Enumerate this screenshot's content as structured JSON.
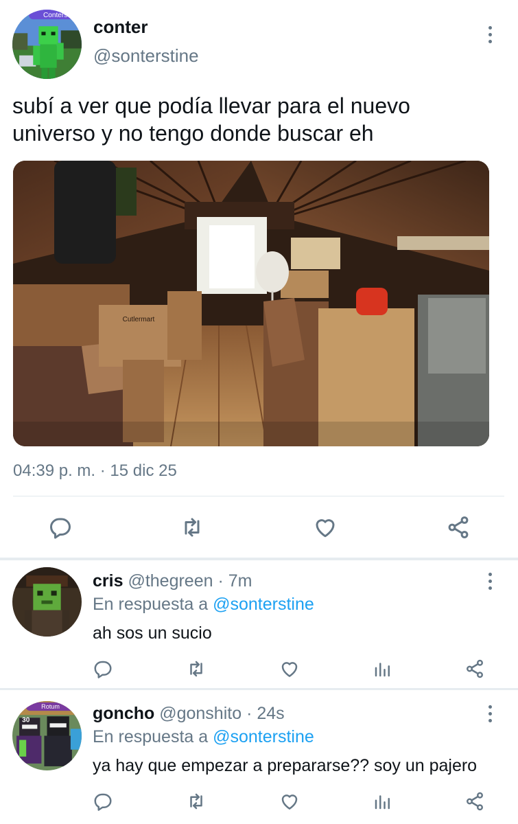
{
  "tweet": {
    "author_name": "conter",
    "author_handle": "@sonterstine",
    "avatar_badge": "Conters",
    "text": "subí a ver que podía llevar para el nuevo universo y no tengo donde buscar eh",
    "timestamp": "04:39 p. m. · 15 dic 25",
    "media_box_text": "Cutlermart",
    "icons": [
      "reply-icon",
      "retweet-icon",
      "like-icon",
      "share-icon"
    ]
  },
  "replies": [
    {
      "author_name": "cris",
      "author_handle": "@thegreen",
      "time_sep": "·",
      "time": "7m",
      "replying_prefix": "En respuesta a",
      "replying_handle": "@sonterstine",
      "text": "ah sos un sucio"
    },
    {
      "author_name": "goncho",
      "author_handle": "@gonshito",
      "time_sep": "·",
      "time": "24s",
      "replying_prefix": "En respuesta a",
      "replying_handle": "@sonterstine",
      "text": "ya hay que empezar a prepararse?? soy un pajero",
      "avatar_badge": "Rotum",
      "avatar_number": "30"
    }
  ],
  "colors": {
    "accent": "#1da1f2",
    "muted": "#657786",
    "text": "#0f1419",
    "divider": "#e1e8ed"
  }
}
